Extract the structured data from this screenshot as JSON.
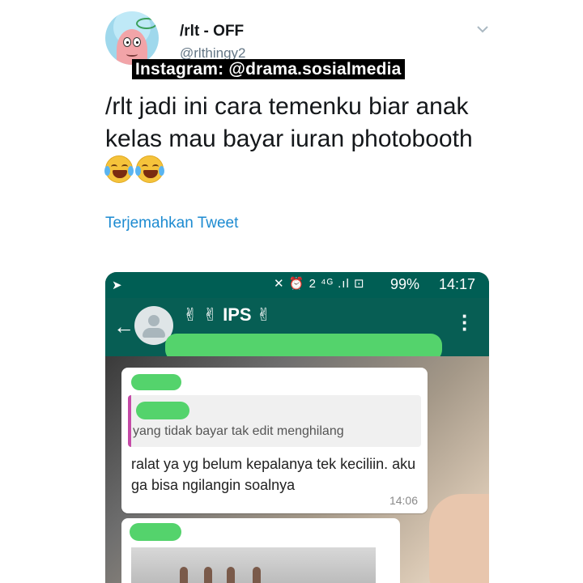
{
  "tweet": {
    "display_name": "/rlt - OFF",
    "handle": "@rlthingy2",
    "watermark": "Instagram: @drama.sosialmedia",
    "text": "/rlt jadi ini cara temenku biar anak kelas mau bayar iuran photobooth",
    "emojis": [
      "tears-of-joy",
      "tears-of-joy"
    ],
    "translate_link": "Terjemahkan Tweet"
  },
  "phone": {
    "status_icons": "✕ ⏰ 2 ⁴ᴳ .ıl ⊡",
    "battery": "99%",
    "time": "14:17",
    "chat_title": "✌ ✌ IPS ✌",
    "quoted_text": "yang tidak bayar tak edit menghilang",
    "message": "ralat ya yg belum kepalanya tek keciliin. aku ga bisa ngilangin soalnya",
    "message_time": "14:06"
  },
  "colors": {
    "link": "#1d8bd1",
    "whatsapp_header": "#075e54",
    "censor_green": "#54d36c"
  }
}
